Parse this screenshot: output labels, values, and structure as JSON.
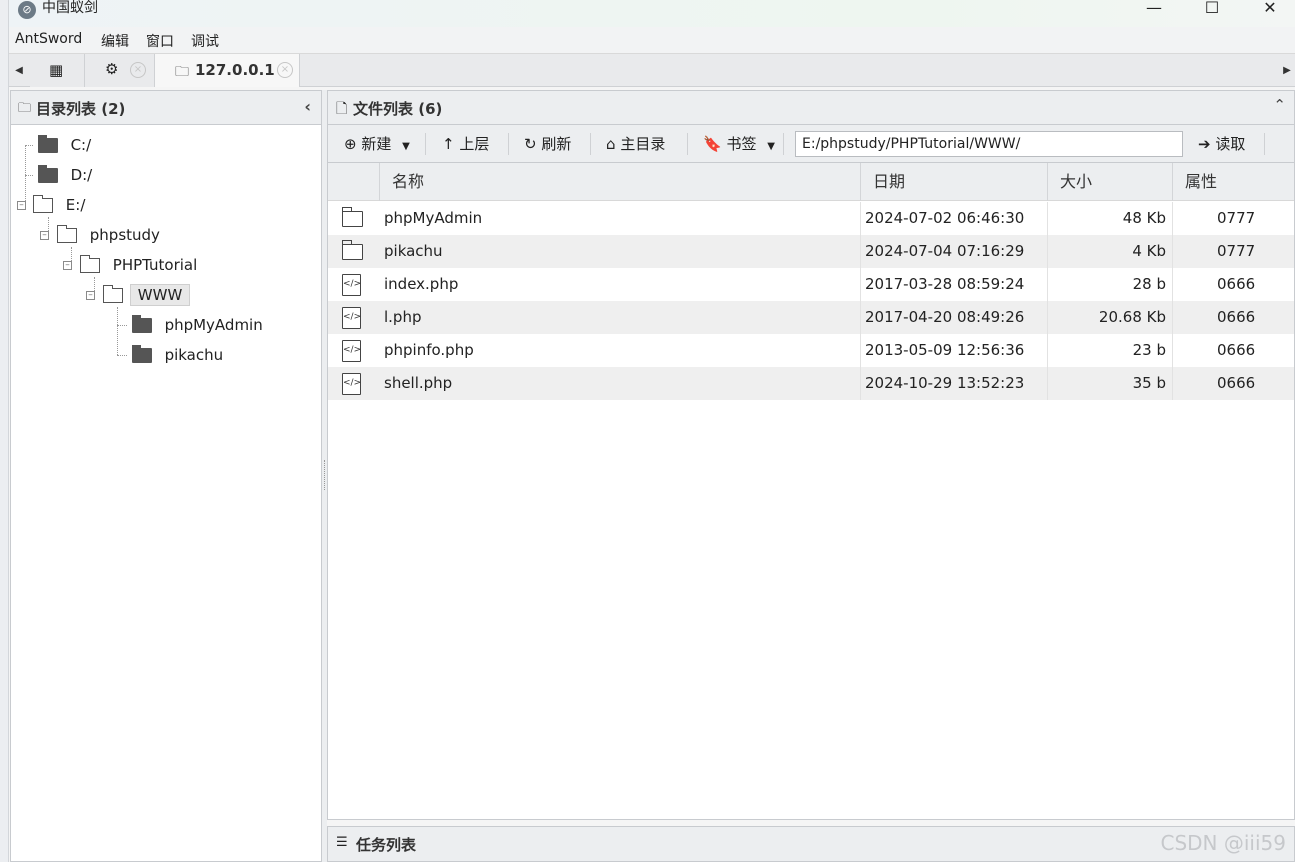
{
  "window": {
    "title": "中国蚁剑",
    "controls": [
      "—",
      "☐",
      "✕"
    ]
  },
  "menu": [
    "AntSword",
    "编辑",
    "窗口",
    "调试"
  ],
  "tabs": {
    "active_label": "127.0.0.1"
  },
  "dir_panel": {
    "title": "目录列表 (2)",
    "tree": [
      {
        "label": "C:/",
        "level": 0,
        "expanded": false
      },
      {
        "label": "D:/",
        "level": 0,
        "expanded": false
      },
      {
        "label": "E:/",
        "level": 0,
        "expanded": true
      },
      {
        "label": "phpstudy",
        "level": 1,
        "expanded": true
      },
      {
        "label": "PHPTutorial",
        "level": 2,
        "expanded": true
      },
      {
        "label": "WWW",
        "level": 3,
        "expanded": true,
        "selected": true
      },
      {
        "label": "phpMyAdmin",
        "level": 4,
        "expanded": false
      },
      {
        "label": "pikachu",
        "level": 4,
        "expanded": false
      }
    ]
  },
  "file_panel": {
    "title": "文件列表 (6)",
    "toolbar": {
      "new": "新建",
      "up": "上层",
      "refresh": "刷新",
      "home": "主目录",
      "bookmark": "书签",
      "path": "E:/phpstudy/PHPTutorial/WWW/",
      "read": "读取"
    },
    "columns": [
      "名称",
      "日期",
      "大小",
      "属性"
    ],
    "files": [
      {
        "type": "dir",
        "name": "phpMyAdmin",
        "date": "2024-07-02 06:46:30",
        "size": "48 Kb",
        "attr": "0777"
      },
      {
        "type": "dir",
        "name": "pikachu",
        "date": "2024-07-04 07:16:29",
        "size": "4 Kb",
        "attr": "0777"
      },
      {
        "type": "file",
        "name": "index.php",
        "date": "2017-03-28 08:59:24",
        "size": "28 b",
        "attr": "0666"
      },
      {
        "type": "file",
        "name": "l.php",
        "date": "2017-04-20 08:49:26",
        "size": "20.68 Kb",
        "attr": "0666"
      },
      {
        "type": "file",
        "name": "phpinfo.php",
        "date": "2013-05-09 12:56:36",
        "size": "23 b",
        "attr": "0666"
      },
      {
        "type": "file",
        "name": "shell.php",
        "date": "2024-10-29 13:52:23",
        "size": "35 b",
        "attr": "0666"
      }
    ]
  },
  "task_panel": {
    "title": "任务列表"
  },
  "watermark": "CSDN @iii59"
}
